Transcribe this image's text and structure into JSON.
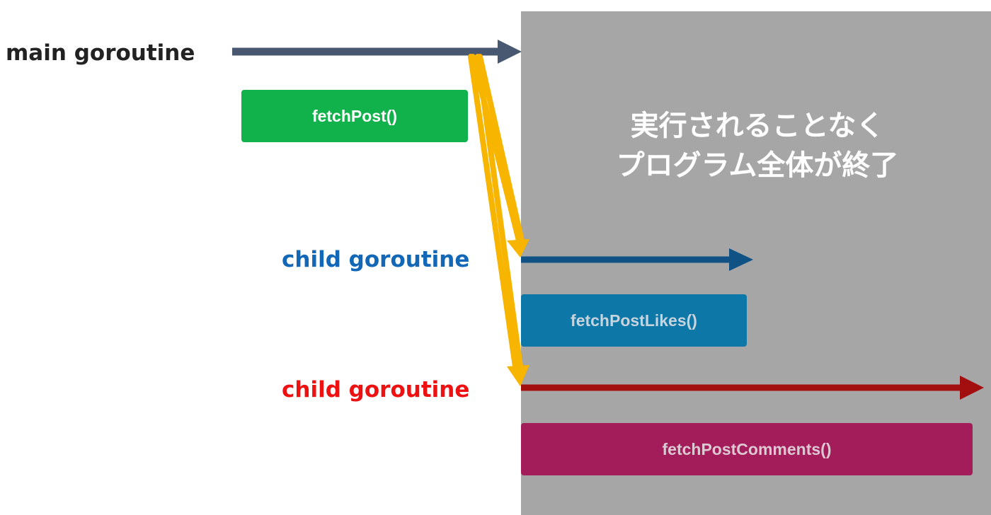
{
  "main_label": "main goroutine",
  "child_label_1": "child goroutine",
  "child_label_2": "child goroutine",
  "functions": {
    "post": "fetchPost()",
    "likes": "fetchPostLikes()",
    "comments": "fetchPostComments()"
  },
  "overlay_text": {
    "line1": "実行されることなく",
    "line2": "プログラム全体が終了"
  },
  "colors": {
    "main_arrow": "#485870",
    "child1_arrow": "#0f5283",
    "child2_arrow": "#a30f0f",
    "spawn_arrow": "#f7b500",
    "overlay": "#a6a6a6"
  }
}
